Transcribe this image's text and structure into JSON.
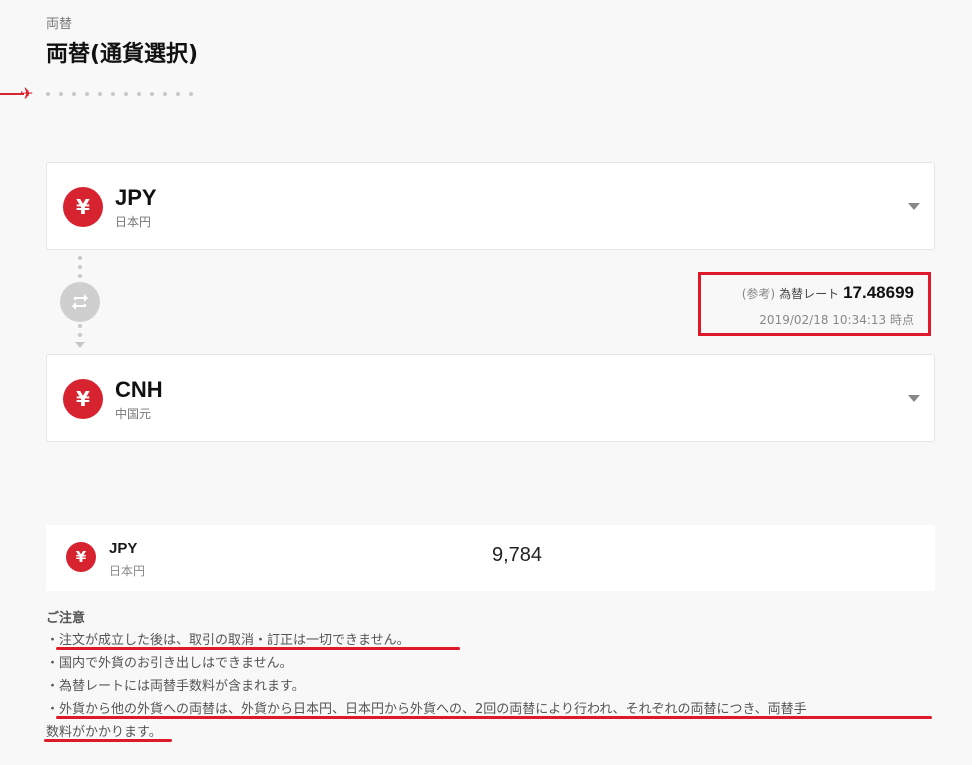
{
  "header": {
    "breadcrumb": "両替",
    "title": "両替(通貨選択)"
  },
  "icons": {
    "plane": "airplane-icon",
    "yen": "yen-icon",
    "swap": "swap-icon",
    "chevron": "chevron-down-icon"
  },
  "colors": {
    "accent": "#d7222f",
    "highlight": "#e0192a"
  },
  "from_currency": {
    "symbol": "¥",
    "code": "JPY",
    "name": "日本円"
  },
  "to_currency": {
    "symbol": "¥",
    "code": "CNH",
    "name": "中国元"
  },
  "rate": {
    "prefix": "(参考)",
    "label": "為替レート",
    "value": "17.48699",
    "timestamp": "2019/02/18 10:34:13 時点"
  },
  "amount": {
    "symbol": "¥",
    "code": "JPY",
    "name": "日本円",
    "value": "9,784"
  },
  "notes": {
    "title": "ご注意",
    "items": [
      "・注文が成立した後は、取引の取消・訂正は一切できません。",
      "・国内で外貨のお引き出しはできません。",
      "・為替レートには両替手数料が含まれます。",
      "・外貨から他の外貨への両替は、外貨から日本円、日本円から外貨への、2回の両替により行われ、それぞれの両替につき、両替手",
      "数料がかかります。"
    ]
  }
}
